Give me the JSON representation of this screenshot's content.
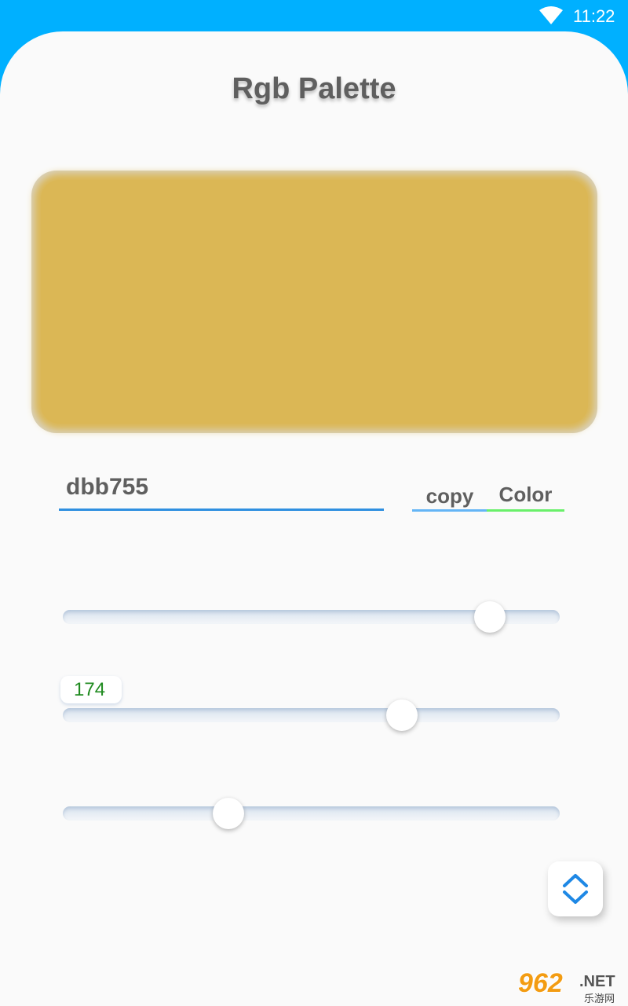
{
  "status_bar": {
    "time": "11:22",
    "wifi_icon": "wifi-icon"
  },
  "header": {
    "title": "Rgb Palette"
  },
  "preview": {
    "color": "#dbb755"
  },
  "hex_input": {
    "value": "dbb755"
  },
  "buttons": {
    "copy_label": "copy",
    "color_label": "Color"
  },
  "sliders": [
    {
      "name": "red",
      "value": 219,
      "max": 255
    },
    {
      "name": "green",
      "value": 174,
      "max": 255
    },
    {
      "name": "blue",
      "value": 85,
      "max": 255
    }
  ],
  "value_badge": {
    "text": "174"
  },
  "fab": {
    "icon": "expand-collapse-icon"
  },
  "watermark": {
    "logo": "962",
    "suffix": ".NET",
    "cn": "乐游网"
  },
  "colors": {
    "accent": "#00b0ff",
    "underline_blue": "#2f8fe0",
    "underline_green": "#69f06a",
    "badge_text": "#1f8a1f"
  }
}
